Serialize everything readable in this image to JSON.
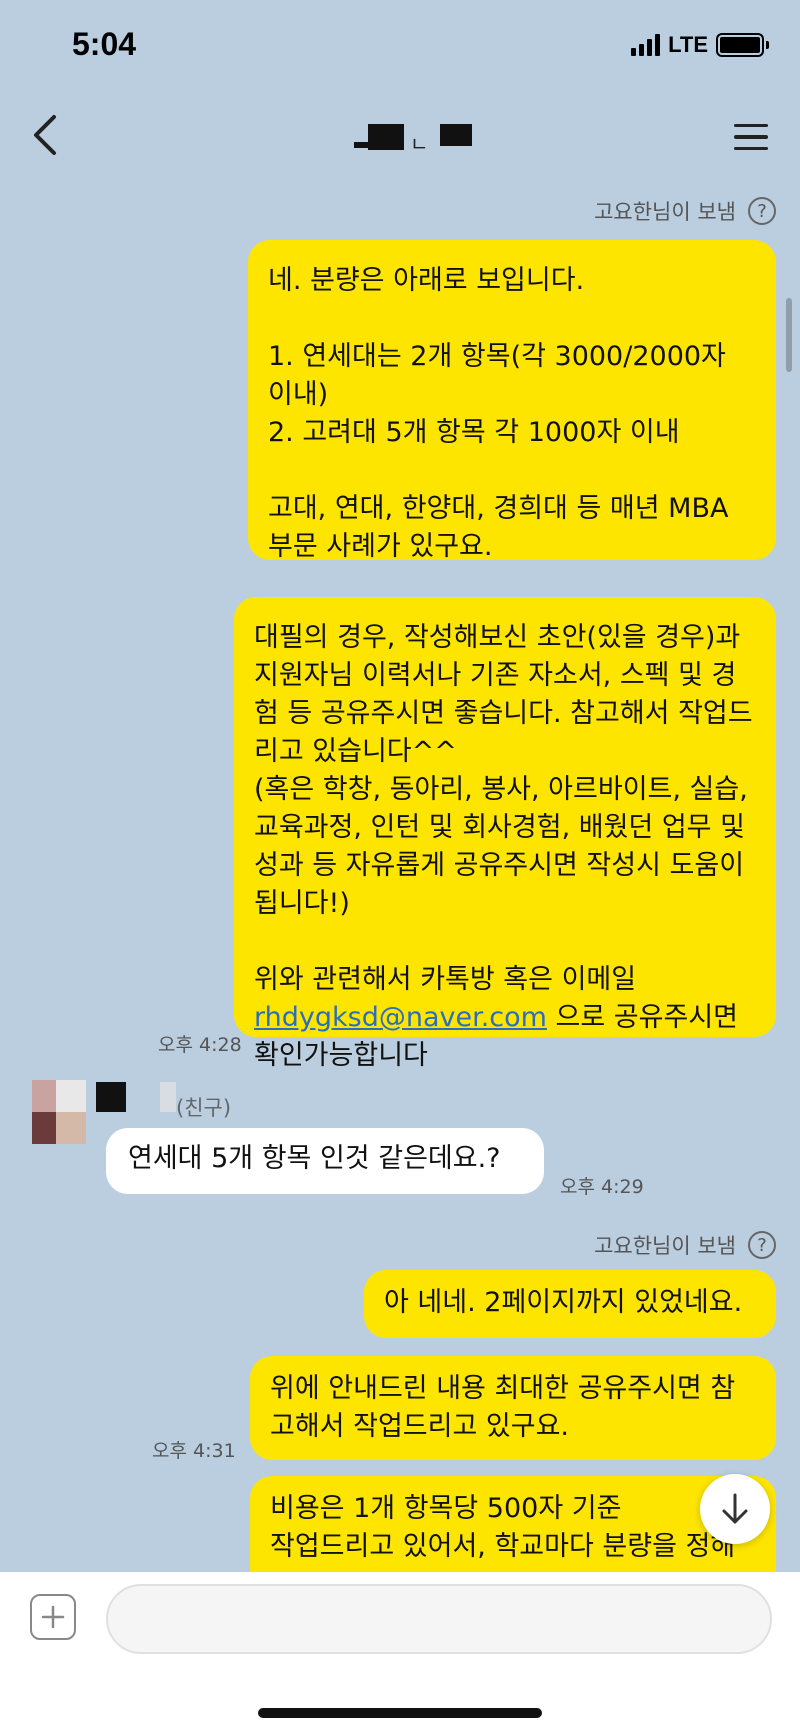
{
  "status": {
    "time": "5:04",
    "network": "LTE"
  },
  "header": {
    "title_separator": "ㄴ"
  },
  "messages": {
    "sender1": "고요한님이 보냄",
    "m1": "네. 분량은 아래로 보입니다.\n\n1. 연세대는 2개 항목(각 3000/2000자 이내)\n2. 고려대 5개 항목 각 1000자 이내\n\n고대, 연대, 한양대, 경희대 등 매년 MBA 부문 사례가 있구요.",
    "m2_text": "대필의 경우, 작성해보신 초안(있을 경우)과 지원자님 이력서나 기존 자소서, 스펙 및 경험 등 공유주시면 좋습니다. 참고해서 작업드리고 있습니다^^\n(혹은 학창, 동아리, 봉사, 아르바이트, 실습, 교육과정, 인턴 및 회사경험, 배웠던 업무 및 성과 등 자유롭게 공유주시면 작성시 도움이 됩니다!)\n\n위와 관련해서 카톡방 혹은 이메일 ",
    "m2_email": "rhdygksd@naver.com",
    "m2_tail": " 으로 공유주시면 확인가능합니다",
    "t1": "오후 4:28",
    "friend_tag": "(친구)",
    "friend_msg": "연세대 5개 항목 인것 같은데요.?",
    "t2": "오후 4:29",
    "sender2": "고요한님이 보냄",
    "m3": "아 네네. 2페이지까지 있었네요.",
    "m4": "위에 안내드린 내용 최대한 공유주시면 참고해서 작업드리고 있구요.",
    "t3": "오후 4:31",
    "m5": "비용은 1개 항목당 500자 기준\n작업드리고 있어서, 학교마다 분량을 정해"
  },
  "input": {
    "placeholder": ""
  },
  "icons": {
    "back": "chevron-left-icon",
    "menu": "hamburger-menu-icon",
    "help": "question-circle-icon",
    "scroll_down": "arrow-down-icon",
    "add": "plus-square-icon"
  },
  "colors": {
    "background": "#bacee0",
    "my_bubble": "#fee500",
    "friend_bubble": "#ffffff"
  }
}
